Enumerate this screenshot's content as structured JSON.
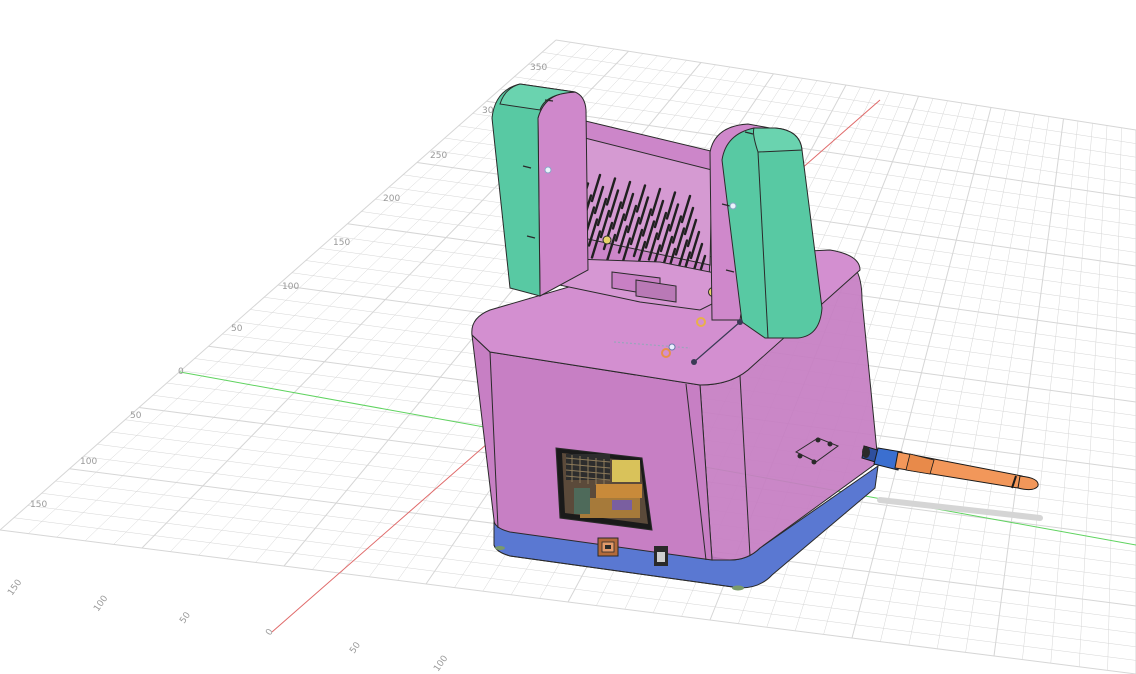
{
  "viewport": {
    "background": "#ffffff",
    "grid_color": "#d6d6d6",
    "axis_x_color": "#e06a6a",
    "axis_y_color": "#5fd35f"
  },
  "model": {
    "body_color": "#cc7fc6",
    "base_color": "#5a78d2",
    "clip_color": "#58c9a3",
    "pen_color": "#f2975a",
    "pen_grip_color": "#3b6fd0"
  },
  "rulers": {
    "back_edge": [
      "350",
      "300",
      "250",
      "200",
      "150",
      "100",
      "50",
      "0",
      "50",
      "100",
      "150"
    ],
    "front_edge": [
      "150",
      "100",
      "50",
      "0",
      "50",
      "100"
    ]
  }
}
